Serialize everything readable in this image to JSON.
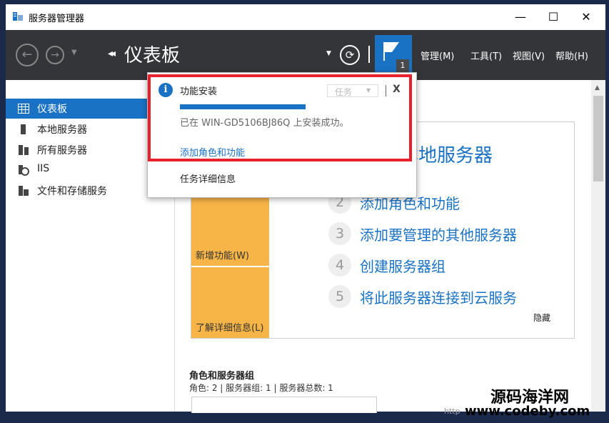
{
  "window": {
    "title": "服务器管理器",
    "controls": {
      "minimize": "—",
      "maximize": "☐",
      "close": "✕"
    }
  },
  "header": {
    "breadcrumb_arrows": "◂◂",
    "breadcrumb": "仪表板",
    "notification_count": "1",
    "menus": [
      "管理(M)",
      "工具(T)",
      "视图(V)",
      "帮助(H)"
    ]
  },
  "sidebar": {
    "items": [
      {
        "label": "仪表板",
        "icon": "dashboard-grid-icon",
        "active": true
      },
      {
        "label": "本地服务器",
        "icon": "server-icon"
      },
      {
        "label": "所有服务器",
        "icon": "servers-icon"
      },
      {
        "label": "IIS",
        "icon": "iis-icon"
      },
      {
        "label": "文件和存储服务",
        "icon": "file-storage-icon"
      }
    ]
  },
  "quick_start": {
    "title": "配置此本地服务器",
    "visible_title": "本地服务器",
    "tiles": [
      "新增功能(W)",
      "了解详细信息(L)"
    ],
    "steps": [
      {
        "num": "2",
        "text": "添加角色和功能"
      },
      {
        "num": "3",
        "text": "添加要管理的其他服务器"
      },
      {
        "num": "4",
        "text": "创建服务器组"
      },
      {
        "num": "5",
        "text": "将此服务器连接到云服务"
      }
    ],
    "hide": "隐藏"
  },
  "roles": {
    "heading": "角色和服务器组",
    "summary": "角色: 2 | 服务器组: 1 | 服务器总数: 1"
  },
  "notification": {
    "title": "功能安装",
    "task_dropdown": "任务",
    "close": "X",
    "progress": 1.0,
    "message": "已在 WIN-GD5106BJ86Q 上安装成功。",
    "link": "添加角色和功能",
    "details": "任务详细信息"
  },
  "watermark": {
    "line1": "源码海洋网",
    "line2": "www.codeby.com",
    "url": "http"
  },
  "colors": {
    "accent": "#1a72c4",
    "header_bg": "#333539",
    "tile": "#f8b547",
    "highlight": "#e8212f"
  }
}
